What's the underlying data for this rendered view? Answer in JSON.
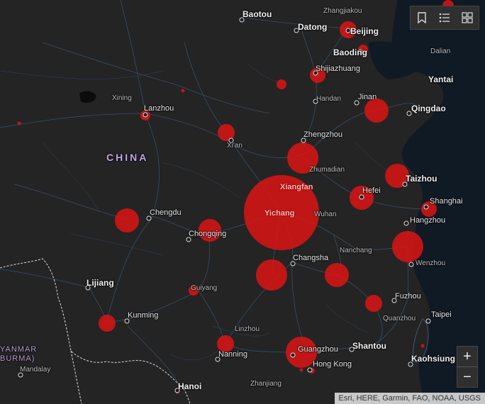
{
  "labels": {
    "baotou": "Baotou",
    "zhangjiakou": "Zhangjiakou",
    "datong": "Datong",
    "beijing": "Beijing",
    "baoding": "Baoding",
    "dalian": "Dalian",
    "shijiazhuang": "Shijiazhuang",
    "yantai": "Yantai",
    "xining": "Xining",
    "lanzhou": "Lanzhou",
    "handan": "Handan",
    "jinan": "Jinan",
    "qingdao": "Qingdao",
    "xian": "Xi'an",
    "zhengzhou": "Zhengzhou",
    "zhumadian": "Zhumadian",
    "taizhou": "Taizhou",
    "china": "CHINA",
    "xiangfan": "Xiangfan",
    "hefei": "Hefei",
    "shanghai": "Shanghai",
    "chengdu": "Chengdu",
    "yichang": "Yichang",
    "wuhan": "Wuhan",
    "hangzhou": "Hangzhou",
    "chongqing": "Chongqing",
    "nanchang": "Nanchang",
    "changsha": "Changsha",
    "wenzhou": "Wenzhou",
    "lijiang": "Lijiang",
    "guiyang": "Guiyang",
    "fuzhou": "Fuzhou",
    "taipei": "Taipei",
    "kunming": "Kunming",
    "quanzhou": "Quanzhou",
    "linzhou": "Linzhou",
    "shantou": "Shantou",
    "myanmar_line1": "YANMAR",
    "myanmar_line2": "BURMA)",
    "mandalay": "Mandalay",
    "nanning": "Nanning",
    "guangzhou": "Guangzhou",
    "hongkong": "Hong Kong",
    "kaohsiung": "Kaohsiung",
    "zhanjiang": "Zhanjiang",
    "hanoi": "Hanoi"
  },
  "toolbar": {
    "bookmark_icon": "bookmark-icon",
    "legend_icon": "legend-icon",
    "basemap_icon": "basemap-gallery-icon"
  },
  "zoom": {
    "in_label": "+",
    "out_label": "−"
  },
  "attribution": "Esri, HERE, Garmin, FAO, NOAA, USGS",
  "colors": {
    "bubble": "#dc1414",
    "land": "#242424",
    "water": "#0f1a24",
    "roads": "#3d5a78"
  }
}
